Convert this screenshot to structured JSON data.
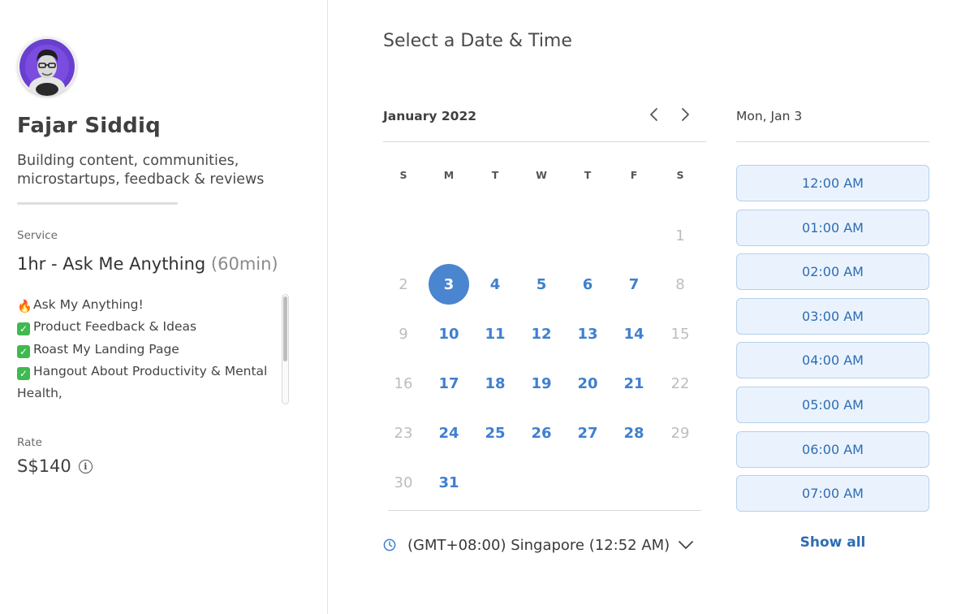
{
  "profile": {
    "name": "Fajar Siddiq",
    "bio": "Building content, communities, microstartups, feedback & reviews",
    "avatar_icon": "avatar-photo-icon"
  },
  "service": {
    "label": "Service",
    "title": "1hr - Ask Me Anything",
    "duration": "(60min)",
    "description": [
      {
        "icon": "fire-icon",
        "text": "Ask My Anything!"
      },
      {
        "icon": "check-icon",
        "text": "Product Feedback & Ideas"
      },
      {
        "icon": "check-icon",
        "text": "Roast My Landing Page"
      },
      {
        "icon": "check-icon",
        "text": "Hangout About Productivity & Mental Health,"
      }
    ]
  },
  "rate": {
    "label": "Rate",
    "value": "S$140",
    "info_icon": "info-icon"
  },
  "scheduler": {
    "heading": "Select a Date & Time",
    "month_label": "January 2022",
    "prev_icon": "chevron-left-icon",
    "next_icon": "chevron-right-icon",
    "weekdays": [
      "S",
      "M",
      "T",
      "W",
      "T",
      "F",
      "S"
    ],
    "weeks": [
      [
        null,
        null,
        null,
        null,
        null,
        null,
        {
          "d": "1",
          "available": false
        }
      ],
      [
        {
          "d": "2",
          "available": false
        },
        {
          "d": "3",
          "available": true,
          "selected": true
        },
        {
          "d": "4",
          "available": true
        },
        {
          "d": "5",
          "available": true
        },
        {
          "d": "6",
          "available": true
        },
        {
          "d": "7",
          "available": true
        },
        {
          "d": "8",
          "available": false
        }
      ],
      [
        {
          "d": "9",
          "available": false
        },
        {
          "d": "10",
          "available": true
        },
        {
          "d": "11",
          "available": true
        },
        {
          "d": "12",
          "available": true
        },
        {
          "d": "13",
          "available": true
        },
        {
          "d": "14",
          "available": true
        },
        {
          "d": "15",
          "available": false
        }
      ],
      [
        {
          "d": "16",
          "available": false
        },
        {
          "d": "17",
          "available": true
        },
        {
          "d": "18",
          "available": true
        },
        {
          "d": "19",
          "available": true
        },
        {
          "d": "20",
          "available": true
        },
        {
          "d": "21",
          "available": true
        },
        {
          "d": "22",
          "available": false
        }
      ],
      [
        {
          "d": "23",
          "available": false
        },
        {
          "d": "24",
          "available": true
        },
        {
          "d": "25",
          "available": true
        },
        {
          "d": "26",
          "available": true
        },
        {
          "d": "27",
          "available": true
        },
        {
          "d": "28",
          "available": true
        },
        {
          "d": "29",
          "available": false
        }
      ],
      [
        {
          "d": "30",
          "available": false
        },
        {
          "d": "31",
          "available": true
        },
        null,
        null,
        null,
        null,
        null
      ]
    ],
    "timezone": "(GMT+08:00) Singapore (12:52 AM)",
    "timezone_icon": "clock-icon",
    "timezone_dropdown_icon": "chevron-down-icon"
  },
  "slots": {
    "selected_date": "Mon, Jan 3",
    "times": [
      "12:00 AM",
      "01:00 AM",
      "02:00 AM",
      "03:00 AM",
      "04:00 AM",
      "05:00 AM",
      "06:00 AM",
      "07:00 AM"
    ],
    "show_all_label": "Show all"
  },
  "colors": {
    "accent": "#4a85cf",
    "accent_text": "#3f7fd0",
    "slot_bg": "#eaf3fd",
    "slot_border": "#b6d0ec",
    "disabled_day": "#bdbdbd"
  }
}
